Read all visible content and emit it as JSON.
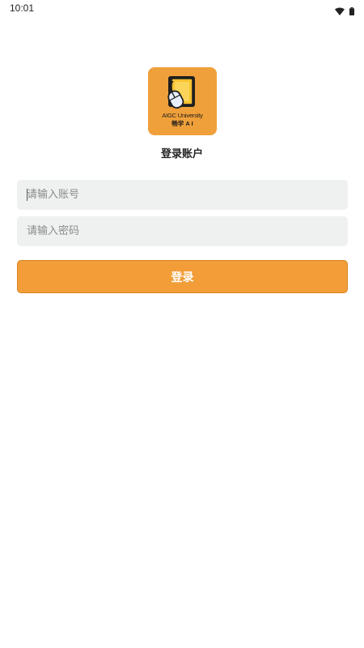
{
  "status_bar": {
    "time": "10:01",
    "icons": [
      "wifi-icon",
      "battery-icon"
    ]
  },
  "logo": {
    "line1": "AIGC University",
    "line2": "畅学 A I",
    "background_color": "#f0a03a"
  },
  "page_title": "登录账户",
  "form": {
    "account_placeholder": "请输入账号",
    "password_placeholder": "请输入密码",
    "login_label": "登录"
  },
  "colors": {
    "accent": "#f29d38",
    "field_background": "#eff1f1"
  }
}
